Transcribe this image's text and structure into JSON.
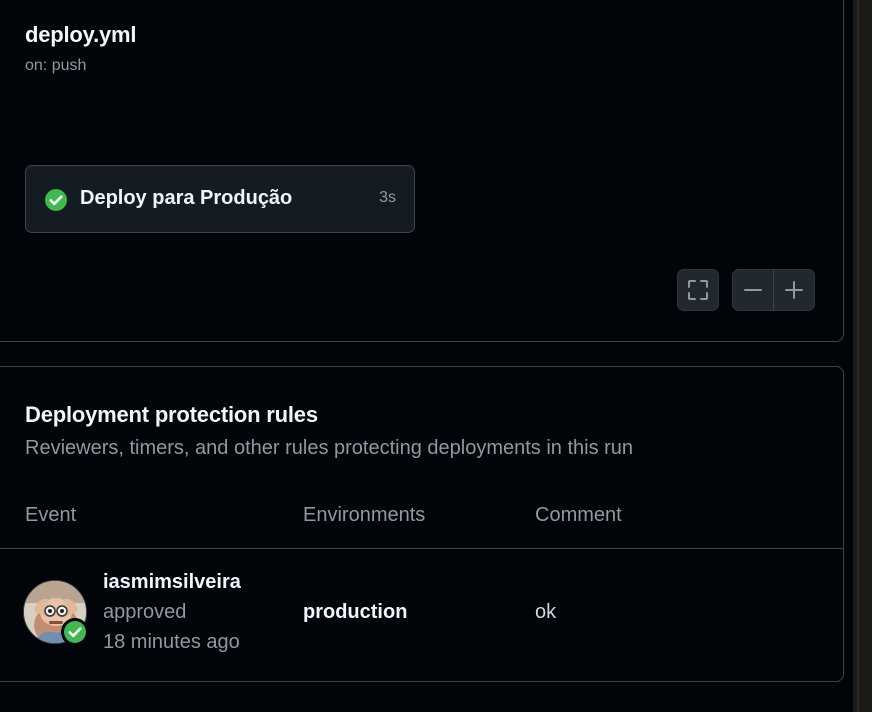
{
  "workflow": {
    "title": "deploy.yml",
    "trigger": "on: push",
    "job": {
      "name": "Deploy para Produção",
      "duration": "3s",
      "status_icon": "check-circle-icon"
    },
    "controls": {
      "fullscreen_icon": "fullscreen-icon",
      "zoom_out_icon": "minus-icon",
      "zoom_in_icon": "plus-icon"
    }
  },
  "rules": {
    "title": "Deployment protection rules",
    "subtitle": "Reviewers, timers, and other rules protecting deployments in this run",
    "columns": {
      "event": "Event",
      "environments": "Environments",
      "comment": "Comment"
    },
    "rows": [
      {
        "reviewer": "iasmimsilveira",
        "state": "approved",
        "time": "18 minutes ago",
        "environment": "production",
        "comment": "ok"
      }
    ]
  },
  "colors": {
    "background": "#010409",
    "card": "#151b23",
    "border": "#3d444d",
    "success": "#3fb950",
    "muted_text": "#9198a1"
  }
}
